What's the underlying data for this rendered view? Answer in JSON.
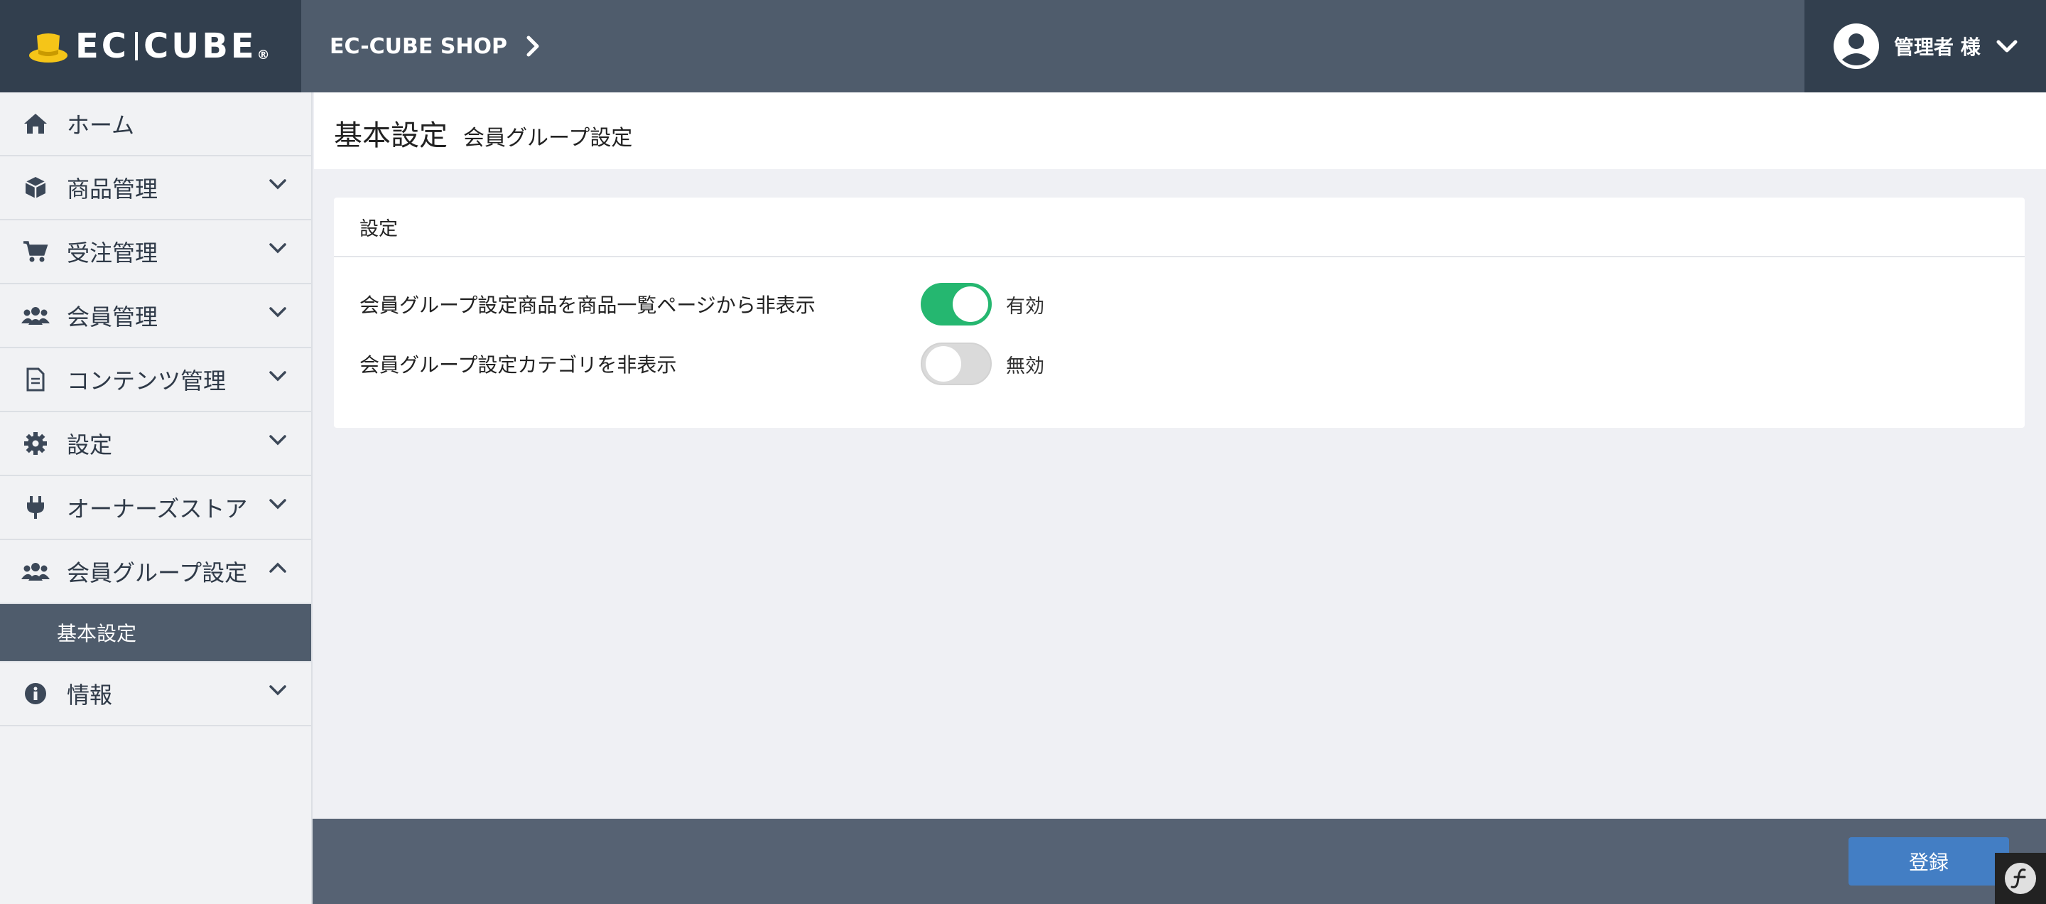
{
  "header": {
    "logo_text_left": "EC",
    "logo_text_right": "CUBE",
    "logo_reg": "®",
    "shop_name": "EC-CUBE SHOP",
    "user_name": "管理者 様"
  },
  "sidebar": {
    "items": [
      {
        "label": "ホーム",
        "icon": "home-icon"
      },
      {
        "label": "商品管理",
        "icon": "box-icon"
      },
      {
        "label": "受注管理",
        "icon": "cart-icon"
      },
      {
        "label": "会員管理",
        "icon": "users-icon"
      },
      {
        "label": "コンテンツ管理",
        "icon": "file-icon"
      },
      {
        "label": "設定",
        "icon": "gear-icon"
      },
      {
        "label": "オーナーズストア",
        "icon": "plug-icon"
      },
      {
        "label": "会員グループ設定",
        "icon": "users-icon"
      },
      {
        "label": "情報",
        "icon": "info-icon"
      }
    ],
    "sub_item": "基本設定"
  },
  "page": {
    "title": "基本設定",
    "subtitle": "会員グループ設定"
  },
  "card": {
    "header": "設定",
    "rows": [
      {
        "label": "会員グループ設定商品を商品一覧ページから非表示",
        "state": "有効",
        "on": true
      },
      {
        "label": "会員グループ設定カテゴリを非表示",
        "state": "無効",
        "on": false
      }
    ]
  },
  "footer": {
    "save_label": "登録"
  },
  "colors": {
    "header_bg": "#4f5c6c",
    "header_dark": "#323f4e",
    "toggle_on": "#25b770",
    "primary": "#437ec4",
    "logo_hat": "#f5c518"
  }
}
